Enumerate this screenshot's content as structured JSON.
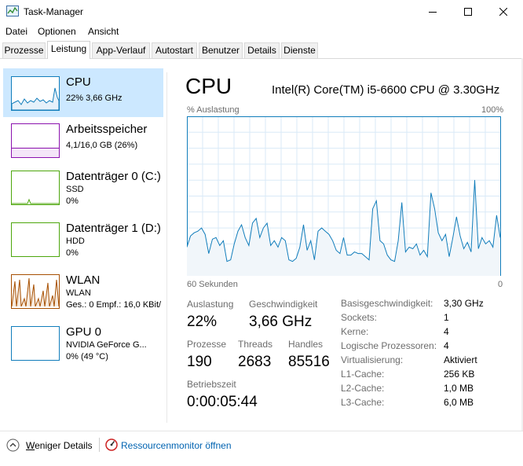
{
  "window": {
    "title": "Task-Manager"
  },
  "menu": [
    "Datei",
    "Optionen",
    "Ansicht"
  ],
  "tabs": [
    "Prozesse",
    "Leistung",
    "App-Verlauf",
    "Autostart",
    "Benutzer",
    "Details",
    "Dienste"
  ],
  "sidebar": {
    "items": [
      {
        "title": "CPU",
        "line1": "22%  3,66 GHz",
        "line2": "",
        "color": "#117dbb"
      },
      {
        "title": "Arbeitsspeicher",
        "line1": "4,1/16,0 GB (26%)",
        "line2": "",
        "color": "#8b12ae"
      },
      {
        "title": "Datenträger 0 (C:)",
        "line1": "SSD",
        "line2": "0%",
        "color": "#4da60c"
      },
      {
        "title": "Datenträger 1 (D:)",
        "line1": "HDD",
        "line2": "0%",
        "color": "#4da60c"
      },
      {
        "title": "WLAN",
        "line1": "WLAN",
        "line2": "Ges.: 0  Empf.: 16,0 KBit/",
        "color": "#a74f01"
      },
      {
        "title": "GPU 0",
        "line1": "NVIDIA GeForce G...",
        "line2": "0% (49 °C)",
        "color": "#117dbb"
      }
    ]
  },
  "main": {
    "title": "CPU",
    "cpu_name": "Intel(R) Core(TM) i5-6600 CPU @ 3.30GHz",
    "graph": {
      "top_left": "% Auslastung",
      "top_right": "100%",
      "bottom_left": "60 Sekunden",
      "bottom_right": "0",
      "color": "#117dbb",
      "fill": "#f1f6fa",
      "usage_percent": [
        18,
        25,
        27,
        28,
        30,
        26,
        14,
        23,
        24,
        19,
        22,
        9,
        10,
        20,
        28,
        32,
        24,
        19,
        33,
        36,
        24,
        30,
        33,
        19,
        22,
        18,
        24,
        22,
        10,
        9,
        11,
        18,
        32,
        16,
        22,
        10,
        28,
        30,
        28,
        26,
        22,
        16,
        14,
        24,
        13,
        13,
        15,
        14,
        14,
        12,
        10,
        42,
        47,
        22,
        20,
        13,
        10,
        9,
        22,
        46,
        15,
        18,
        17,
        20,
        13,
        16,
        12,
        52,
        42,
        27,
        22,
        26,
        12,
        24,
        37,
        25,
        17,
        21,
        15,
        60,
        17,
        24,
        20,
        22,
        18,
        38,
        24
      ]
    },
    "stats": {
      "auslastung_label": "Auslastung",
      "auslastung": "22%",
      "speed_label": "Geschwindigkeit",
      "speed": "3,66 GHz",
      "processes_label": "Prozesse",
      "processes": "190",
      "threads_label": "Threads",
      "threads": "2683",
      "handles_label": "Handles",
      "handles": "85516",
      "uptime_label": "Betriebszeit",
      "uptime": "0:00:05:44"
    },
    "details": [
      {
        "label": "Basisgeschwindigkeit:",
        "value": "3,30 GHz"
      },
      {
        "label": "Sockets:",
        "value": "1"
      },
      {
        "label": "Kerne:",
        "value": "4"
      },
      {
        "label": "Logische Prozessoren:",
        "value": "4"
      },
      {
        "label": "Virtualisierung:",
        "value": "Aktiviert"
      },
      {
        "label": "L1-Cache:",
        "value": "256 KB"
      },
      {
        "label": "L2-Cache:",
        "value": "1,0 MB"
      },
      {
        "label": "L3-Cache:",
        "value": "6,0 MB"
      }
    ]
  },
  "footer": {
    "fewer_details": "Weniger Details",
    "resource_monitor": "Ressourcenmonitor öffnen"
  }
}
